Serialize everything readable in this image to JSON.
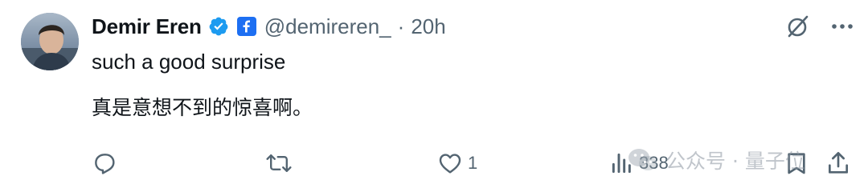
{
  "tweet": {
    "author": {
      "display_name": "Demir Eren",
      "handle": "@demireren_",
      "verified": true,
      "verified_color": "#1d9bf0",
      "org_badge_color": "#1d6ff2"
    },
    "separator": "·",
    "timestamp": "20h",
    "text_lines": [
      "such a good surprise",
      "真是意想不到的惊喜啊。"
    ]
  },
  "actions": {
    "reply": {
      "icon": "reply-icon",
      "count": ""
    },
    "retweet": {
      "icon": "retweet-icon",
      "count": ""
    },
    "like": {
      "icon": "heart-icon",
      "count": "1"
    },
    "views": {
      "icon": "views-icon",
      "count": "338"
    },
    "bookmark": {
      "icon": "bookmark-icon"
    },
    "share": {
      "icon": "share-icon"
    }
  },
  "top_actions": {
    "grok": {
      "icon": "grok-icon"
    },
    "more": {
      "icon": "more-icon"
    }
  },
  "watermark": {
    "text": "公众号 · 量子位"
  },
  "colors": {
    "text_primary": "#0f1419",
    "text_secondary": "#536471",
    "background": "#ffffff"
  }
}
